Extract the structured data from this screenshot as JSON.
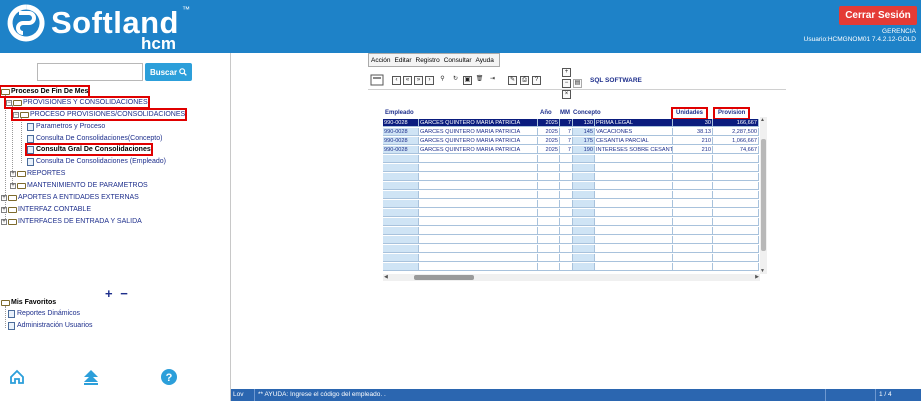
{
  "header": {
    "logo_text": "Softland",
    "logo_tm": "™",
    "logo_sub": "hcm",
    "logout_label": "Cerrar Sesión",
    "info_line1": "GERENCIA",
    "info_line2": "Usuario:HCMGNOM01 7.4.2.12-GOLD",
    "bg_color": "#1E82C8",
    "logout_color": "#E43B36"
  },
  "search": {
    "value": "",
    "button_label": "Buscar"
  },
  "tree": {
    "root": "Proceso De Fin De Mes",
    "n1": "PROVISIONES Y CONSOLIDACIONES",
    "n2": "PROCESO PROVISIONES/CONSOLIDACIONES",
    "n3": "Parametros y Proceso",
    "n4": "Consulta De Consolidaciones(Concepto)",
    "n5": "Consulta Gral De Consolidaciones",
    "n6": "Consulta De Consolidaciones (Empleado)",
    "n7": "REPORTES",
    "n8": "MANTENIMIENTO DE PARAMETROS",
    "n9": "APORTES A ENTIDADES EXTERNAS",
    "n10": "INTERFAZ CONTABLE",
    "n11": "INTERFACES DE ENTRADA Y SALIDA"
  },
  "favorites": {
    "plus_minus": "+ −",
    "title": "Mis Favoritos",
    "items": [
      "Reportes Dinámicos",
      "Administración Usuarios"
    ]
  },
  "menu": {
    "items": [
      "Acción",
      "Editar",
      "Registro",
      "Consultar",
      "Ayuda"
    ]
  },
  "brand_label": "SQL SOFTWARE",
  "table": {
    "headers": {
      "empleado": "Empleado",
      "ano": "Año",
      "mm": "MM",
      "concepto": "Concepto",
      "unidades": "Unidades",
      "provision": "Provision"
    },
    "rows": [
      {
        "emp": "990-0028",
        "name": "GARCES QUINTERO MARIA PATRICIA",
        "ano": "2025",
        "mm": "7",
        "cod": "130",
        "desc": "PRIMA LEGAL",
        "unid": "30",
        "prov": "166,667"
      },
      {
        "emp": "990-0028",
        "name": "GARCES QUINTERO MARIA PATRICIA",
        "ano": "2025",
        "mm": "7",
        "cod": "145",
        "desc": "VACACIONES",
        "unid": "38.13",
        "prov": "2,287,500"
      },
      {
        "emp": "990-0028",
        "name": "GARCES QUINTERO MARIA PATRICIA",
        "ano": "2025",
        "mm": "7",
        "cod": "175",
        "desc": "CESANTIA PARCIAL",
        "unid": "210",
        "prov": "1,066,667"
      },
      {
        "emp": "990-0028",
        "name": "GARCES QUINTERO MARIA PATRICIA",
        "ano": "2025",
        "mm": "7",
        "cod": "190",
        "desc": "INTERESES SOBRE CESANTIA",
        "unid": "210",
        "prov": "74,667"
      }
    ]
  },
  "status": {
    "mode": "Lov",
    "message": "** AYUDA: Ingrese el código del empleado. .",
    "page": "1 / 4",
    "bg_color": "#2B66B0"
  }
}
